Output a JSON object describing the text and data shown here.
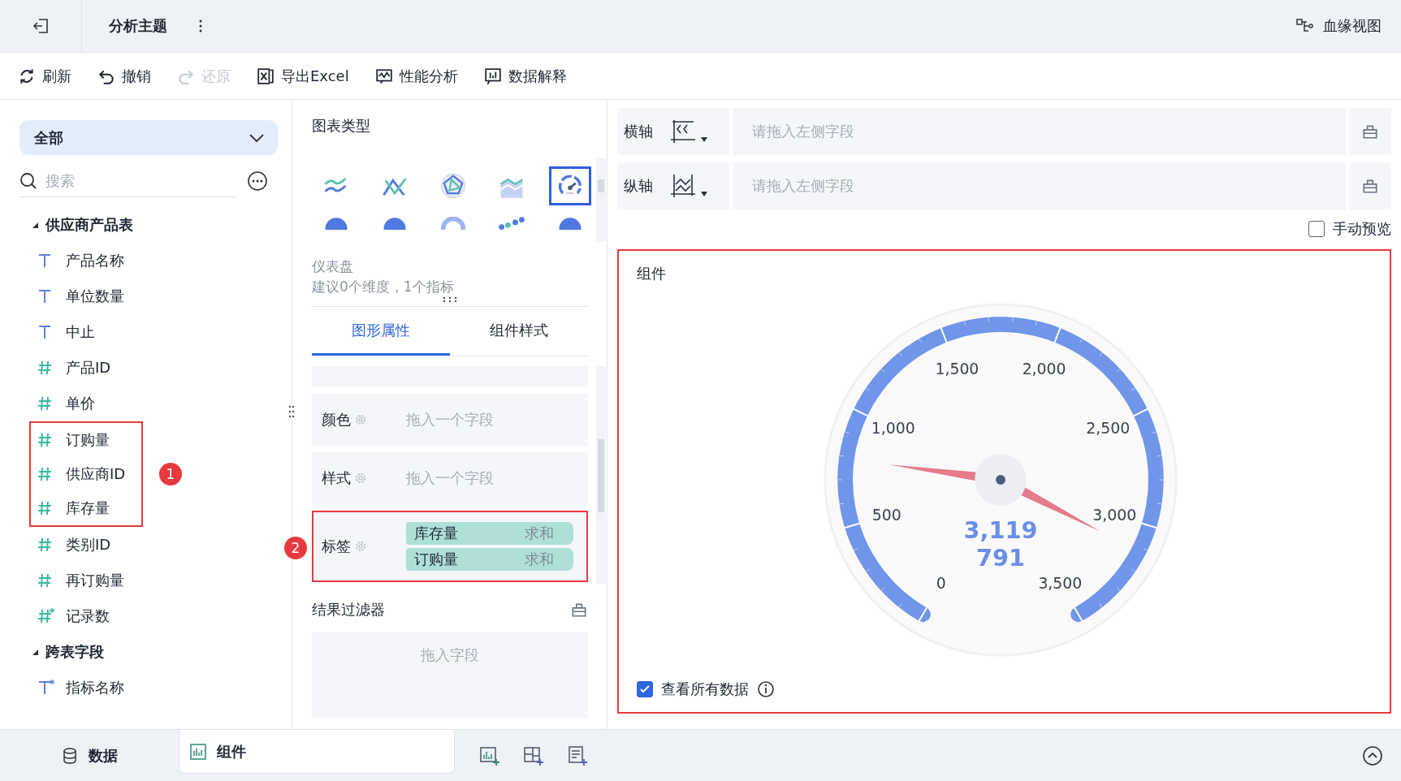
{
  "header": {
    "title": "分析主题",
    "lineage_button": "血缘视图"
  },
  "toolbar": [
    {
      "label": "刷新",
      "disabled": false
    },
    {
      "label": "撤销",
      "disabled": false
    },
    {
      "label": "还原",
      "disabled": true
    },
    {
      "label": "导出Excel",
      "disabled": false
    },
    {
      "label": "性能分析",
      "disabled": false
    },
    {
      "label": "数据解释",
      "disabled": false
    }
  ],
  "sidebar": {
    "scope": "全部",
    "search_placeholder": "搜索",
    "groups": [
      {
        "name": "供应商产品表",
        "expanded": true,
        "badge": "1",
        "children": [
          {
            "name": "产品名称",
            "kind": "text",
            "calculated": false,
            "highlighted": false
          },
          {
            "name": "单位数量",
            "kind": "text",
            "calculated": false,
            "highlighted": false
          },
          {
            "name": "中止",
            "kind": "text",
            "calculated": false,
            "highlighted": false
          },
          {
            "name": "产品ID",
            "kind": "number",
            "calculated": false,
            "highlighted": false
          },
          {
            "name": "单价",
            "kind": "number",
            "calculated": false,
            "highlighted": false
          },
          {
            "name": "订购量",
            "kind": "number",
            "calculated": false,
            "highlighted": true
          },
          {
            "name": "供应商ID",
            "kind": "number",
            "calculated": false,
            "highlighted": true
          },
          {
            "name": "库存量",
            "kind": "number",
            "calculated": false,
            "highlighted": true
          },
          {
            "name": "类别ID",
            "kind": "number",
            "calculated": false,
            "highlighted": false
          },
          {
            "name": "再订购量",
            "kind": "number",
            "calculated": false,
            "highlighted": false
          },
          {
            "name": "记录数",
            "kind": "number",
            "calculated": true,
            "highlighted": false
          }
        ]
      },
      {
        "name": "跨表字段",
        "expanded": true,
        "children": [
          {
            "name": "指标名称",
            "kind": "text",
            "calculated": true,
            "highlighted": false
          }
        ]
      }
    ]
  },
  "chart_panel": {
    "title": "图表类型",
    "chart_types": [
      {
        "kind": "dual-line",
        "selected": false
      },
      {
        "kind": "cross-line",
        "selected": false
      },
      {
        "kind": "radar",
        "selected": false
      },
      {
        "kind": "area",
        "selected": false
      },
      {
        "kind": "gauge",
        "selected": true
      },
      {
        "kind": "pie",
        "selected": false
      },
      {
        "kind": "pie",
        "selected": false
      },
      {
        "kind": "ring",
        "selected": false
      },
      {
        "kind": "scatter",
        "selected": false
      },
      {
        "kind": "pie",
        "selected": false
      }
    ],
    "chart_name": "仪表盘",
    "hint": "建议0个维度，1个指标",
    "tabs": [
      {
        "label": "图形属性",
        "selected": true
      },
      {
        "label": "组件样式",
        "selected": false
      }
    ],
    "properties": [
      {
        "label": "颜色",
        "placeholder": "拖入一个字段"
      },
      {
        "label": "样式",
        "placeholder": "拖入一个字段"
      },
      {
        "label": "标签",
        "badge": "2",
        "fields": [
          {
            "name": "库存量",
            "aggregation": "求和"
          },
          {
            "name": "订购量",
            "aggregation": "求和"
          }
        ]
      }
    ],
    "filter": {
      "title": "结果过滤器",
      "placeholder": "拖入字段"
    }
  },
  "axes": [
    {
      "label": "横轴",
      "kind": "horizontal",
      "placeholder": "请拖入左侧字段"
    },
    {
      "label": "纵轴",
      "kind": "vertical",
      "placeholder": "请拖入左侧字段"
    }
  ],
  "manual_preview": {
    "label": "手动预览",
    "checked": false
  },
  "component": {
    "title": "组件",
    "gauge": {
      "ticks": [
        "0",
        "500",
        "1,000",
        "1,500",
        "2,000",
        "2,500",
        "3,000",
        "3,500"
      ],
      "values": [
        {
          "label": "3,119"
        },
        {
          "label": "791"
        }
      ]
    },
    "show_all": {
      "label": "查看所有数据",
      "checked": true
    }
  },
  "bottom_tabs": [
    {
      "label": "数据",
      "selected": false
    },
    {
      "label": "组件",
      "selected": true
    }
  ]
}
